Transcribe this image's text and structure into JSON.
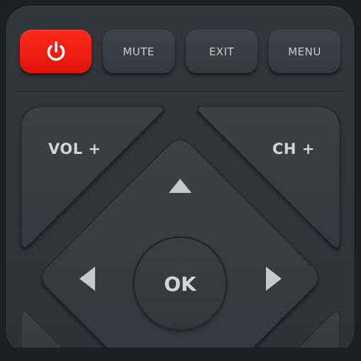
{
  "remote": {
    "top_row": {
      "power_icon": "power-icon",
      "mute_label": "MUTE",
      "exit_label": "EXIT",
      "menu_label": "MENU"
    },
    "volume_up_label": "VOL +",
    "channel_up_label": "CH +",
    "ok_label": "OK",
    "arrows": {
      "up": "triangle-up-icon",
      "left": "triangle-left-icon",
      "right": "triangle-right-icon"
    }
  },
  "colors": {
    "power": "#e8170d",
    "button": "#3a3d40",
    "body": "#313437",
    "label": "#d2d4d6"
  }
}
